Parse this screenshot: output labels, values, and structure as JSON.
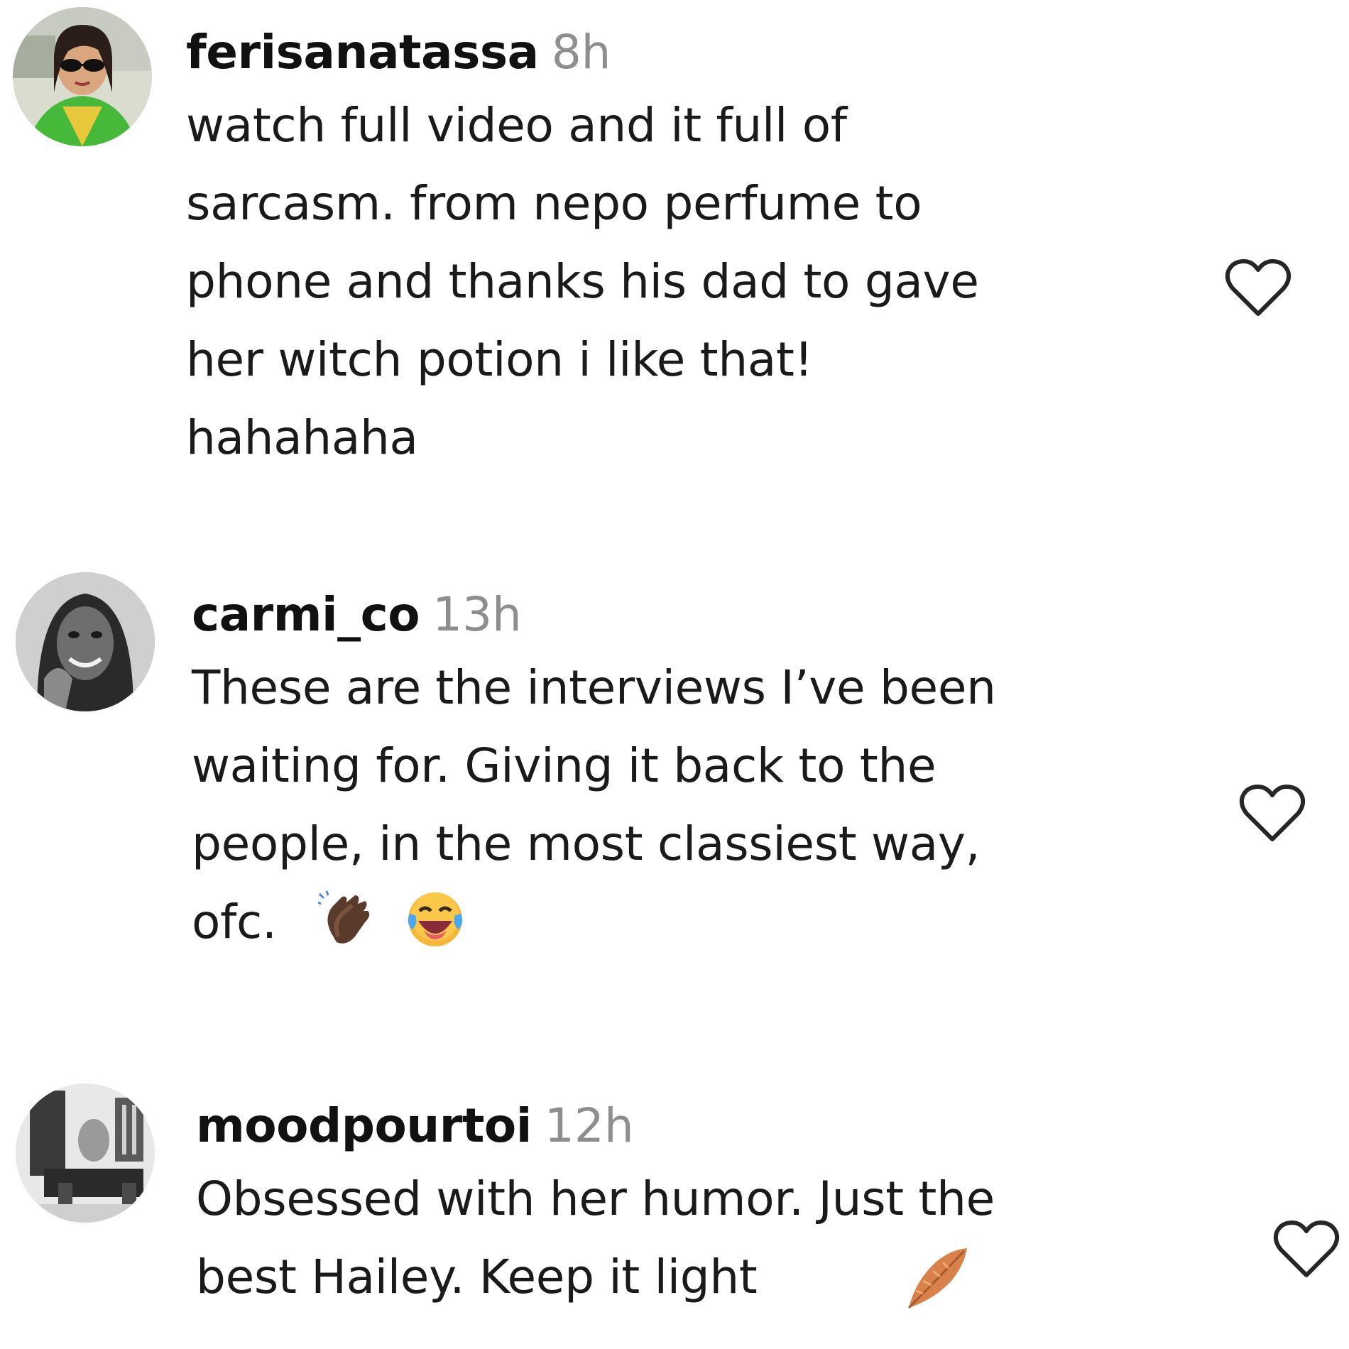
{
  "comments": [
    {
      "username": "ferisanatassa",
      "time": "8h",
      "text": "watch full video and it full of\nsarcasm. from nepo perfume to\nphone and thanks his dad to gave\nher witch potion i like that!\nhahahaha",
      "avatar_icon": "profile-photo-woman-sunglasses-green",
      "like_icon": "heart-outline-icon",
      "emojis": []
    },
    {
      "username": "carmi_co",
      "time": "13h",
      "text": "These are the interviews I’ve been\nwaiting for. Giving it back to the\npeople, in the most classiest way,\nofc.",
      "avatar_icon": "profile-photo-woman-smiling-grayscale",
      "like_icon": "heart-outline-icon",
      "emojis": [
        "clapping-hands-emoji",
        "tears-of-joy-emoji"
      ]
    },
    {
      "username": "moodpourtoi",
      "time": "12h",
      "text": "Obsessed with her humor. Just the\nbest Hailey. Keep it light",
      "avatar_icon": "profile-photo-room-grayscale",
      "like_icon": "heart-outline-icon",
      "emojis": [
        "feather-emoji"
      ]
    }
  ],
  "colors": {
    "username": "#111111",
    "timestamp": "#8e8e8e",
    "text": "#1a1a1a",
    "heart_stroke": "#262626"
  }
}
